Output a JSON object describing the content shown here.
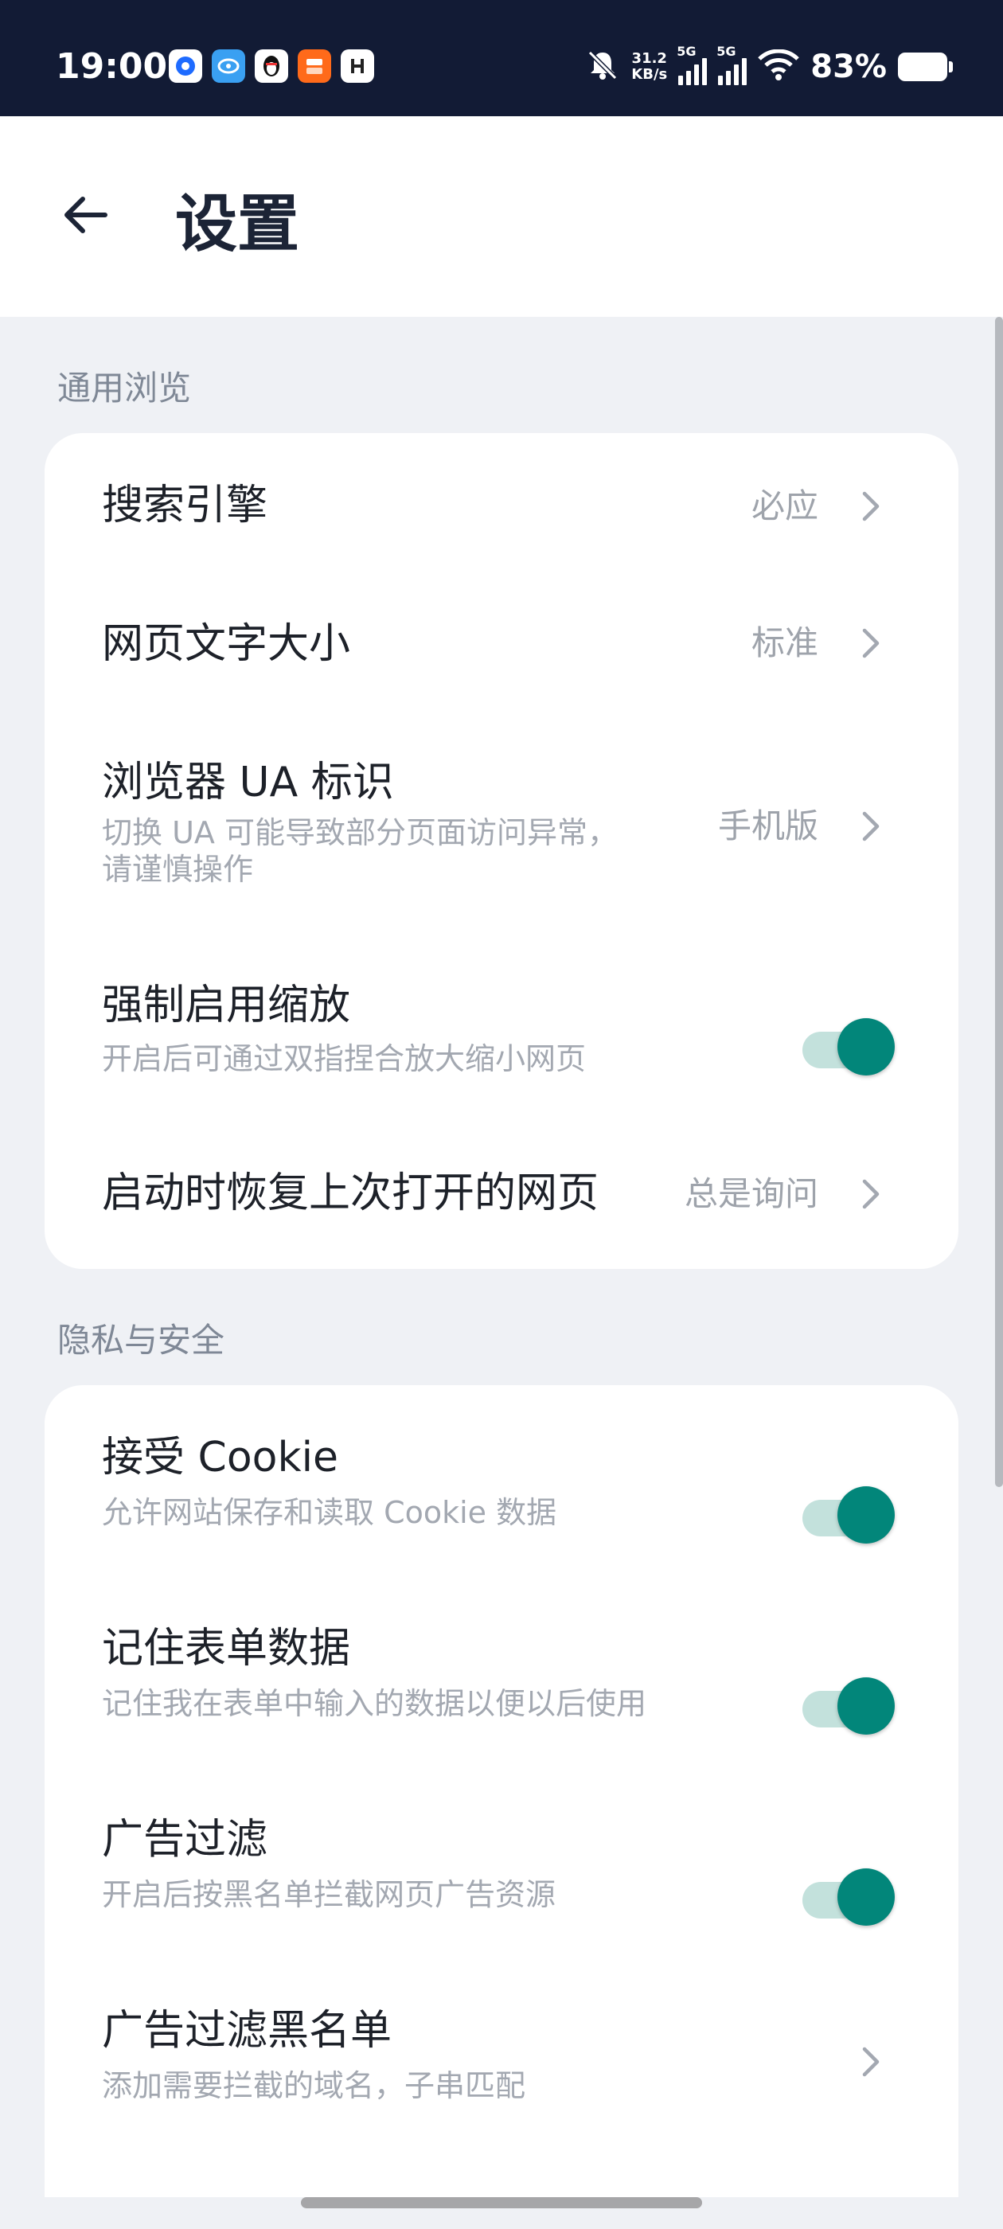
{
  "status_bar": {
    "time": "19:00",
    "net_speed_value": "31.2",
    "net_speed_unit": "KB/s",
    "sim1_label": "5G",
    "sim2_label": "5G",
    "battery_percent": "83%",
    "battery_level": 0.83,
    "app_icons": [
      "app-notification-icon",
      "browser-app-icon",
      "qq-penguin-icon",
      "taobao-flash-icon",
      "clip-app-icon"
    ]
  },
  "app_bar": {
    "title": "设置"
  },
  "sections": {
    "general": {
      "header": "通用浏览",
      "items": [
        {
          "title": "搜索引擎",
          "value": "必应"
        },
        {
          "title": "网页文字大小",
          "value": "标准"
        },
        {
          "title": "浏览器 UA 标识",
          "subtitle_line1": "切换 UA 可能导致部分页面访问异常，",
          "subtitle_line2": "请谨慎操作",
          "value": "手机版"
        },
        {
          "title": "强制启用缩放",
          "subtitle": "开启后可通过双指捏合放大缩小网页",
          "enabled": true
        },
        {
          "title": "启动时恢复上次打开的网页",
          "value": "总是询问"
        }
      ]
    },
    "privacy": {
      "header": "隐私与安全",
      "items": [
        {
          "title": "接受 Cookie",
          "subtitle": "允许网站保存和读取 Cookie 数据",
          "enabled": true
        },
        {
          "title": "记住表单数据",
          "subtitle": "记住我在表单中输入的数据以便以后使用",
          "enabled": true
        },
        {
          "title": "广告过滤",
          "subtitle": "开启后按黑名单拦截网页广告资源",
          "enabled": true
        },
        {
          "title": "广告过滤黑名单",
          "subtitle": "添加需要拦截的域名，子串匹配"
        }
      ]
    }
  },
  "colors": {
    "status_bar_bg": "#121b35",
    "page_bg": "#eff1f5",
    "accent": "#02867a",
    "accent_track": "#c3e1dc"
  }
}
